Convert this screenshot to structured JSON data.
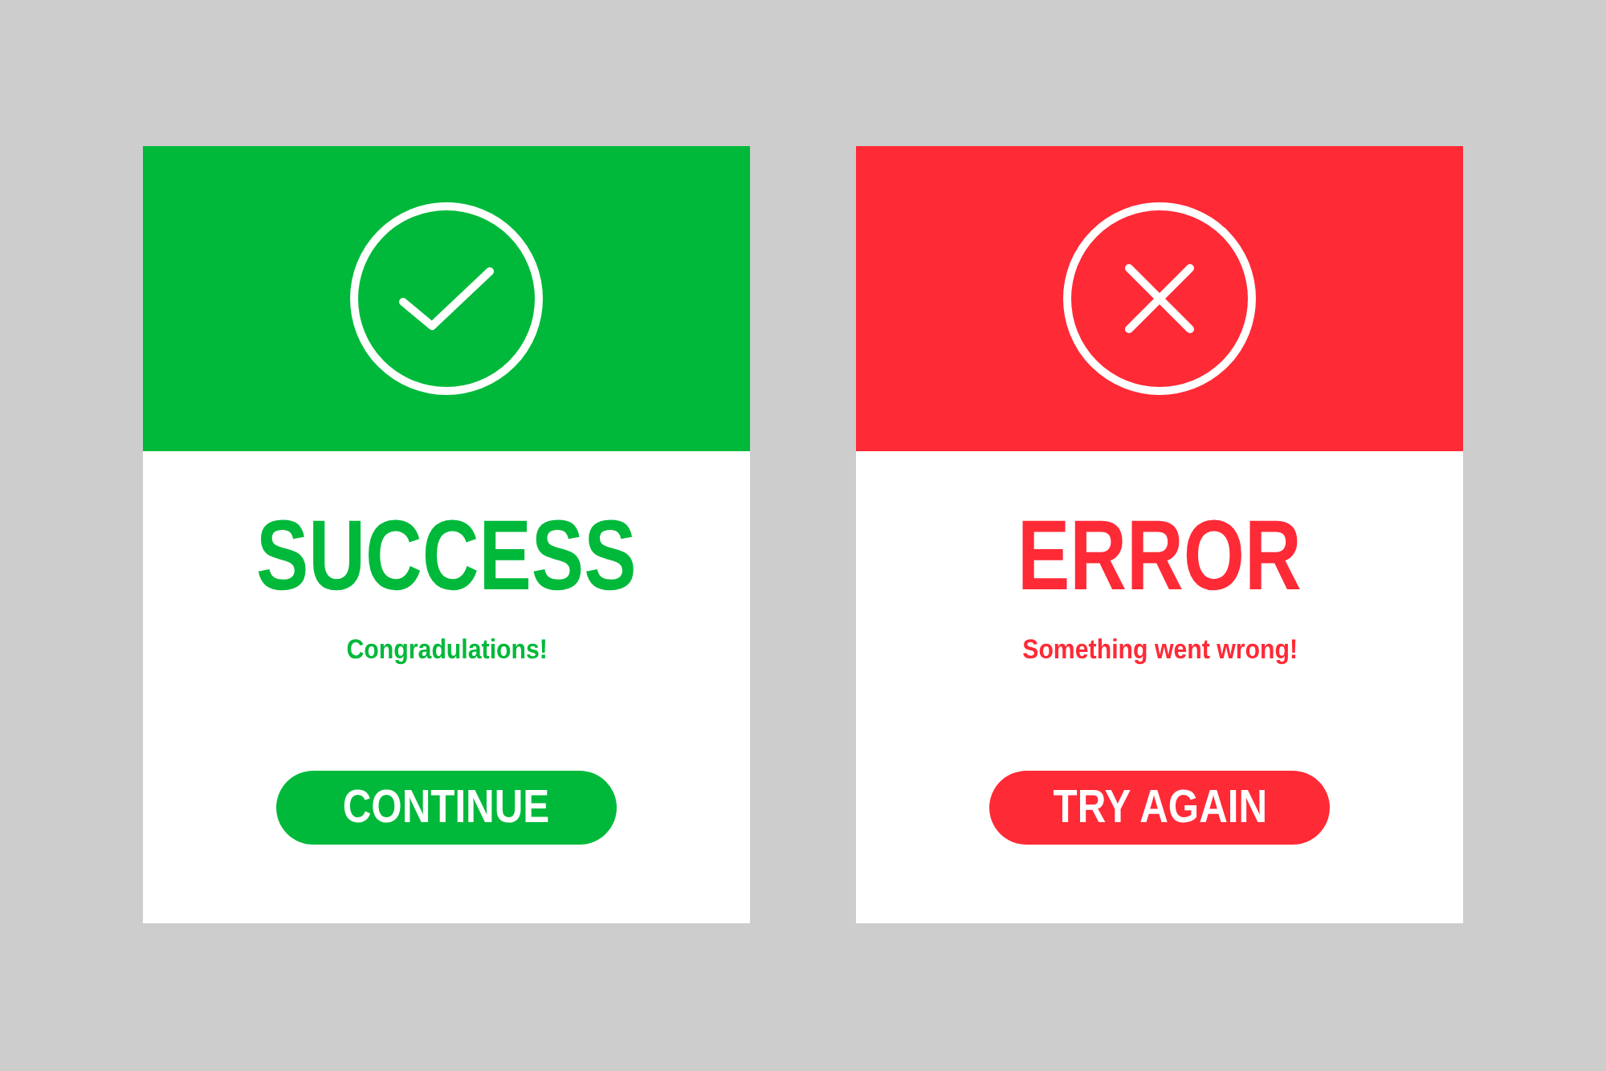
{
  "cards": [
    {
      "kind": "success",
      "color": "#00b93a",
      "title": "SUCCESS",
      "message": "Congradulations!",
      "button": "CONTINUE"
    },
    {
      "kind": "error",
      "color": "#fe2a36",
      "title": "ERROR",
      "message": "Something went wrong!",
      "button": "TRY AGAIN"
    }
  ]
}
